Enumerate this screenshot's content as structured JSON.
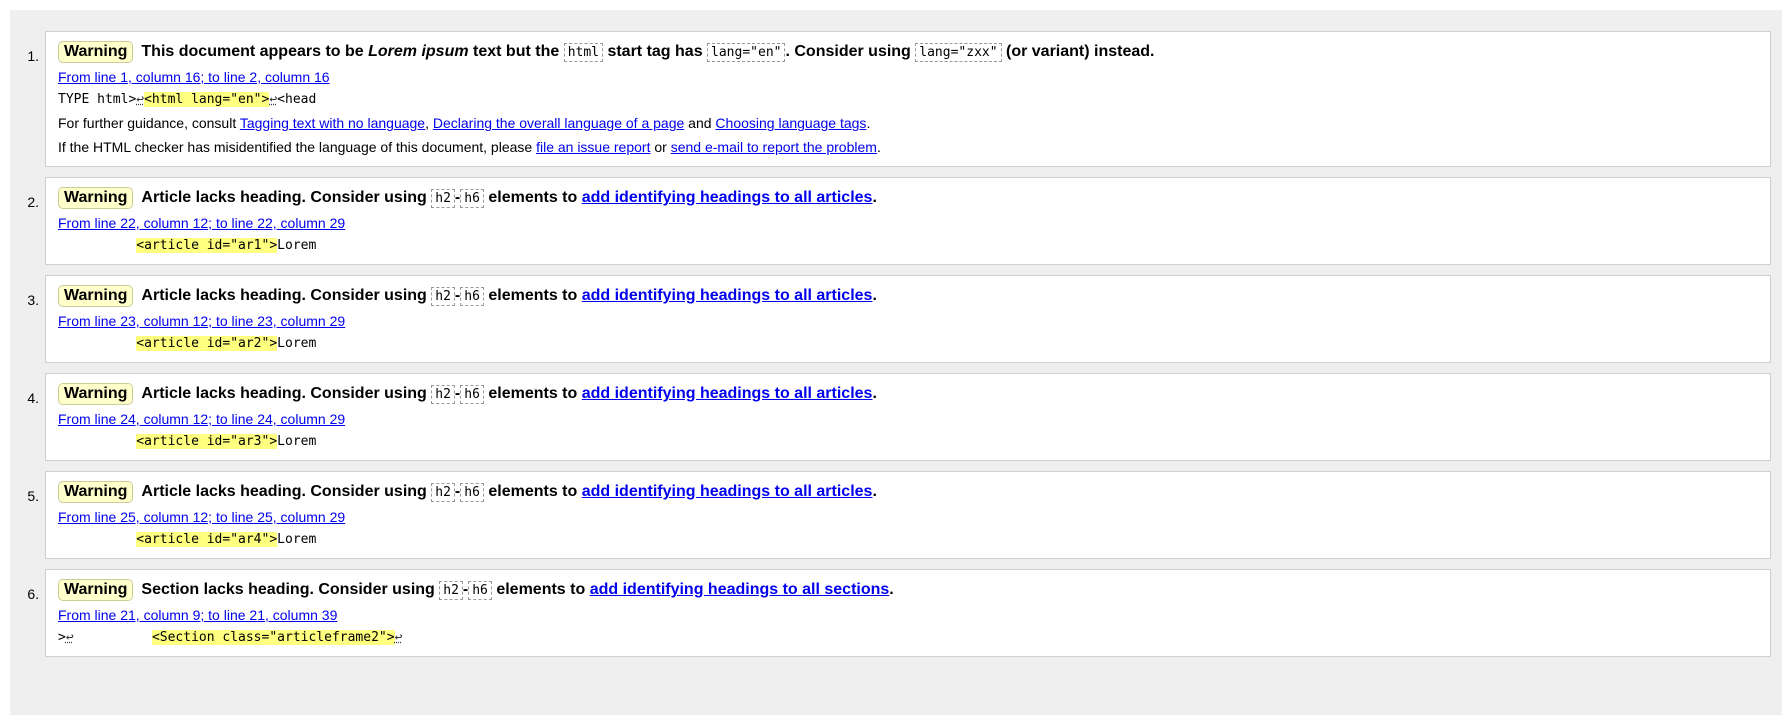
{
  "badge_label": "Warning",
  "messages": [
    {
      "number": "1.",
      "text_a": "This document appears to be ",
      "text_em": "Lorem ipsum",
      "text_b": " text but the ",
      "code1": "html",
      "text_c": " start tag has ",
      "code2": "lang=\"en\"",
      "text_d": ". Consider using ",
      "code3": "lang=\"zxx\"",
      "text_e": " (or variant) instead.",
      "location": "From line 1, column 16; to line 2, column 16",
      "extract_pre": "TYPE html>",
      "extract_lf1": "↩",
      "extract_hl": "<html lang=\"en\">",
      "extract_lf2": "↩",
      "extract_post": "<head",
      "guidance_prefix": "For further guidance, consult ",
      "guidance_link1": "Tagging text with no language",
      "guidance_sep1": ", ",
      "guidance_link2": "Declaring the overall language of a page",
      "guidance_sep2": " and ",
      "guidance_link3": "Choosing language tags",
      "guidance_suffix": ".",
      "report_prefix": "If the HTML checker has misidentified the language of this document, please ",
      "report_link1": "file an issue report",
      "report_sep": " or ",
      "report_link2": "send e-mail to report the problem",
      "report_suffix": "."
    },
    {
      "number": "2.",
      "text_a": "Article lacks heading. Consider using ",
      "code1": "h2",
      "dash": "-",
      "code2": "h6",
      "text_b": " elements to ",
      "link": "add identifying headings to all articles",
      "end": ".",
      "location": "From line 22, column 12; to line 22, column 29",
      "extract_pre": "          ",
      "extract_hl": "<article id=\"ar1\">",
      "extract_post": "Lorem"
    },
    {
      "number": "3.",
      "text_a": "Article lacks heading. Consider using ",
      "code1": "h2",
      "dash": "-",
      "code2": "h6",
      "text_b": " elements to ",
      "link": "add identifying headings to all articles",
      "end": ".",
      "location": "From line 23, column 12; to line 23, column 29",
      "extract_pre": "          ",
      "extract_hl": "<article id=\"ar2\">",
      "extract_post": "Lorem"
    },
    {
      "number": "4.",
      "text_a": "Article lacks heading. Consider using ",
      "code1": "h2",
      "dash": "-",
      "code2": "h6",
      "text_b": " elements to ",
      "link": "add identifying headings to all articles",
      "end": ".",
      "location": "From line 24, column 12; to line 24, column 29",
      "extract_pre": "          ",
      "extract_hl": "<article id=\"ar3\">",
      "extract_post": "Lorem"
    },
    {
      "number": "5.",
      "text_a": "Article lacks heading. Consider using ",
      "code1": "h2",
      "dash": "-",
      "code2": "h6",
      "text_b": " elements to ",
      "link": "add identifying headings to all articles",
      "end": ".",
      "location": "From line 25, column 12; to line 25, column 29",
      "extract_pre": "          ",
      "extract_hl": "<article id=\"ar4\">",
      "extract_post": "Lorem"
    },
    {
      "number": "6.",
      "text_a": "Section lacks heading. Consider using ",
      "code1": "h2",
      "dash": "-",
      "code2": "h6",
      "text_b": " elements to ",
      "link": "add identifying headings to all sections",
      "end": ".",
      "location": "From line 21, column 9; to line 21, column 39",
      "extract_pre": ">",
      "extract_lf1": "↩",
      "extract_gap": "          ",
      "extract_hl": "<Section class=\"articleframe2\">",
      "extract_lf2": "↩"
    }
  ]
}
